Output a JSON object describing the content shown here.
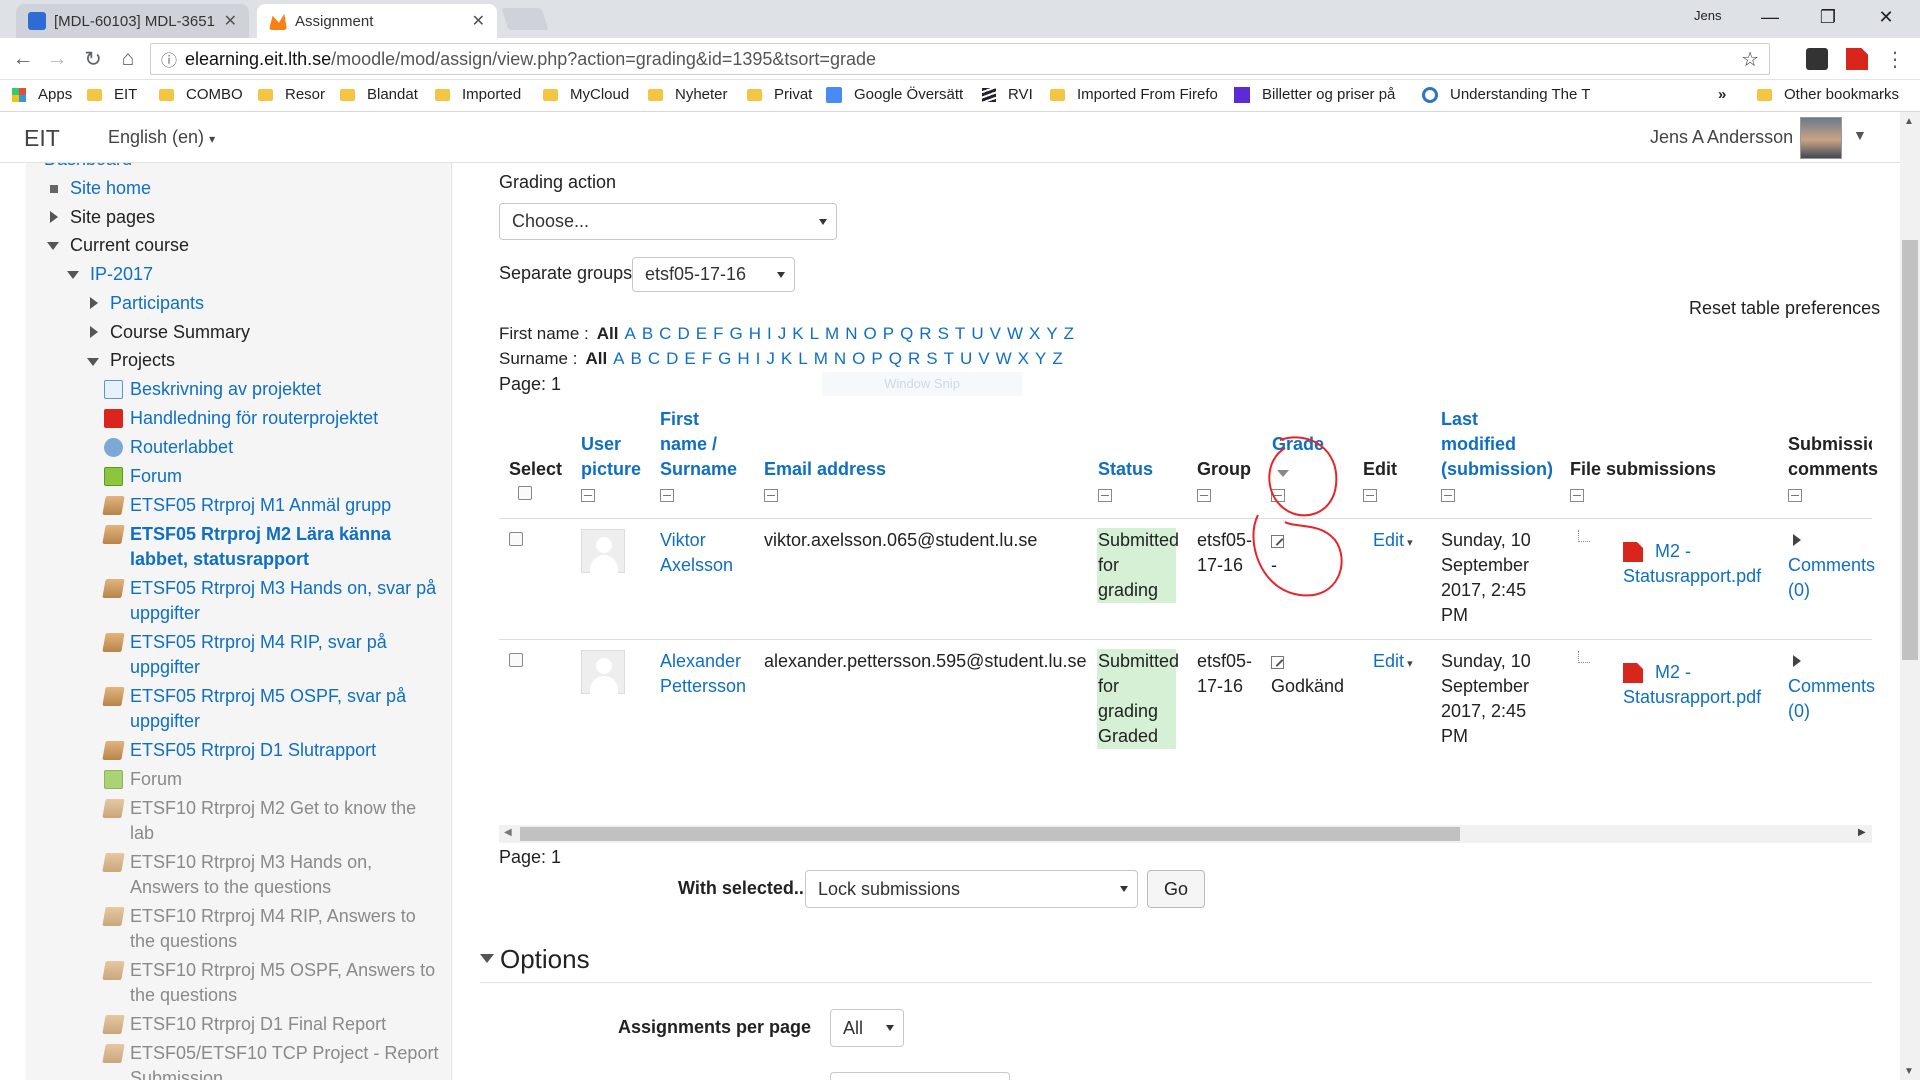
{
  "browser": {
    "tabs": [
      {
        "title": "[MDL-60103] MDL-3651…",
        "favicon": "jira-icon"
      },
      {
        "title": "Assignment",
        "favicon": "moodle-icon"
      }
    ],
    "profile_name": "Jens",
    "url_host": "elearning.eit.lth.se",
    "url_path": "/moodle/mod/assign/view.php?action=grading&id=1395&tsort=grade",
    "bookmarks": [
      "Apps",
      "EIT",
      "COMBO",
      "Resor",
      "Blandat",
      "Imported",
      "MyCloud",
      "Nyheter",
      "Privat",
      "Google Översätt",
      "RVI",
      "Imported From Firefo",
      "Billetter og priser på",
      "Understanding The T"
    ],
    "bookmarks_more": "»",
    "other_bookmarks": "Other bookmarks"
  },
  "moodle": {
    "site_name": "EIT",
    "language": "English (en)",
    "user_name": "Jens A Andersson"
  },
  "sidebar": {
    "dashboard": "Dashboard",
    "site_home": "Site home",
    "site_pages": "Site pages",
    "current_course": "Current course",
    "course": "IP-2017",
    "participants": "Participants",
    "course_summary": "Course Summary",
    "projects": "Projects",
    "items": [
      {
        "l1": "Beskrivning av projektet",
        "l2": ""
      },
      {
        "l1": "Handledning för routerprojektet",
        "l2": ""
      },
      {
        "l1": "Routerlabbet",
        "l2": ""
      },
      {
        "l1": "Forum",
        "l2": ""
      },
      {
        "l1": "ETSF05 Rtrproj M1 Anmäl grupp",
        "l2": ""
      },
      {
        "l1": "ETSF05 Rtrproj M2 Lära känna",
        "l2": "labbet, statusrapport"
      },
      {
        "l1": "ETSF05 Rtrproj M3 Hands on, svar på",
        "l2": "uppgifter"
      },
      {
        "l1": "ETSF05 Rtrproj M4 RIP, svar på",
        "l2": "uppgifter"
      },
      {
        "l1": "ETSF05 Rtrproj M5 OSPF, svar på",
        "l2": "uppgifter"
      },
      {
        "l1": "ETSF05 Rtrproj D1 Slutrapport",
        "l2": ""
      },
      {
        "l1": "Forum",
        "l2": ""
      },
      {
        "l1": "ETSF10 Rtrproj M2 Get to know the",
        "l2": "lab"
      },
      {
        "l1": "ETSF10 Rtrproj M3 Hands on,",
        "l2": "Answers to the questions"
      },
      {
        "l1": "ETSF10 Rtrproj M4 RIP, Answers to",
        "l2": "the questions"
      },
      {
        "l1": "ETSF10 Rtrproj M5 OSPF, Answers to",
        "l2": "the questions"
      },
      {
        "l1": "ETSF10 Rtrproj D1 Final Report",
        "l2": ""
      },
      {
        "l1": "ETSF05/ETSF10 TCP Project - Report",
        "l2": "Submission"
      }
    ]
  },
  "main": {
    "grading_action_label": "Grading action",
    "grading_action_value": "Choose...",
    "separate_groups_label": "Separate groups",
    "separate_groups_value": "etsf05-17-16",
    "reset_prefs": "Reset table preferences",
    "first_name_label": "First name :",
    "surname_label": "Surname :",
    "letters": [
      "All",
      "A",
      "B",
      "C",
      "D",
      "E",
      "F",
      "G",
      "H",
      "I",
      "J",
      "K",
      "L",
      "M",
      "N",
      "O",
      "P",
      "Q",
      "R",
      "S",
      "T",
      "U",
      "V",
      "W",
      "X",
      "Y",
      "Z"
    ],
    "page_label": "Page: 1",
    "window_snip": "Window Snip",
    "headers": {
      "select": "Select",
      "user_picture_1": "User",
      "user_picture_2": "picture",
      "name_1": "First",
      "name_2": "name /",
      "name_3": "Surname",
      "email": "Email address",
      "status": "Status",
      "group": "Group",
      "grade": "Grade",
      "edit": "Edit",
      "last_mod_1": "Last",
      "last_mod_2": "modified",
      "last_mod_3": "(submission)",
      "file_submissions": "File submissions",
      "sub_comments_1": "Submissic",
      "sub_comments_2": "comments"
    },
    "rows": [
      {
        "first": "Viktor",
        "last": "Axelsson",
        "email": "viktor.axelsson.065@student.lu.se",
        "status": [
          "Submitted",
          "for",
          "grading"
        ],
        "group": [
          "etsf05-",
          "17-16"
        ],
        "grade": "-",
        "edit": "Edit",
        "modified": [
          "Sunday, 10",
          "September",
          "2017, 2:45",
          "PM"
        ],
        "file": [
          "M2 -",
          "Statusrapport.pdf"
        ],
        "comments": [
          "Comments",
          "(0)"
        ]
      },
      {
        "first": "Alexander",
        "last": "Pettersson",
        "email": "alexander.pettersson.595@student.lu.se",
        "status": [
          "Submitted",
          "for",
          "grading",
          "Graded"
        ],
        "group": [
          "etsf05-",
          "17-16"
        ],
        "grade": "Godkänd",
        "edit": "Edit",
        "modified": [
          "Sunday, 10",
          "September",
          "2017, 2:45",
          "PM"
        ],
        "file": [
          "M2 -",
          "Statusrapport.pdf"
        ],
        "comments": [
          "Comments",
          "(0)"
        ]
      }
    ],
    "page_label_bottom": "Page: 1",
    "with_selected_label": "With selected...",
    "with_selected_value": "Lock submissions",
    "go_button": "Go",
    "options_title": "Options",
    "assignments_per_page_label": "Assignments per page",
    "assignments_per_page_value": "All"
  },
  "colors": {
    "link": "#0f6fc5",
    "status_bg": "#d5f0d5",
    "annotation": "#e8232a"
  }
}
